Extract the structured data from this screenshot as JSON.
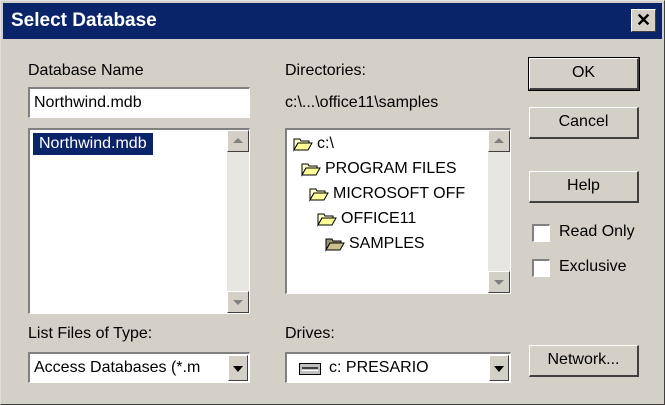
{
  "window": {
    "title": "Select Database"
  },
  "db_name": {
    "label": "Database Name",
    "value": "Northwind.mdb"
  },
  "file_list": {
    "items": [
      "Northwind.mdb"
    ],
    "selected": 0
  },
  "directories": {
    "label": "Directories:",
    "path": "c:\\...\\office11\\samples",
    "items": [
      "c:\\",
      "PROGRAM FILES",
      "MICROSOFT OFF",
      "OFFICE11",
      "SAMPLES"
    ],
    "selected": "SAMPLES"
  },
  "buttons": {
    "ok": "OK",
    "cancel": "Cancel",
    "help": "Help",
    "network": "Network..."
  },
  "options": {
    "read_only": {
      "label": "Read Only",
      "checked": false
    },
    "exclusive": {
      "label": "Exclusive",
      "checked": false
    }
  },
  "file_type": {
    "label": "List Files of Type:",
    "value": "Access Databases (*.mdb)",
    "display": "Access Databases (*.m"
  },
  "drives": {
    "label": "Drives:",
    "value": "c: PRESARIO"
  },
  "icons": {
    "close": "close-icon",
    "folder": "folder-icon",
    "drive": "drive-icon",
    "dropdown": "chevron-down-icon"
  },
  "colors": {
    "title_bar": "#0a246a",
    "selection": "#0a246a",
    "dialog_bg": "#d4d0c8"
  }
}
